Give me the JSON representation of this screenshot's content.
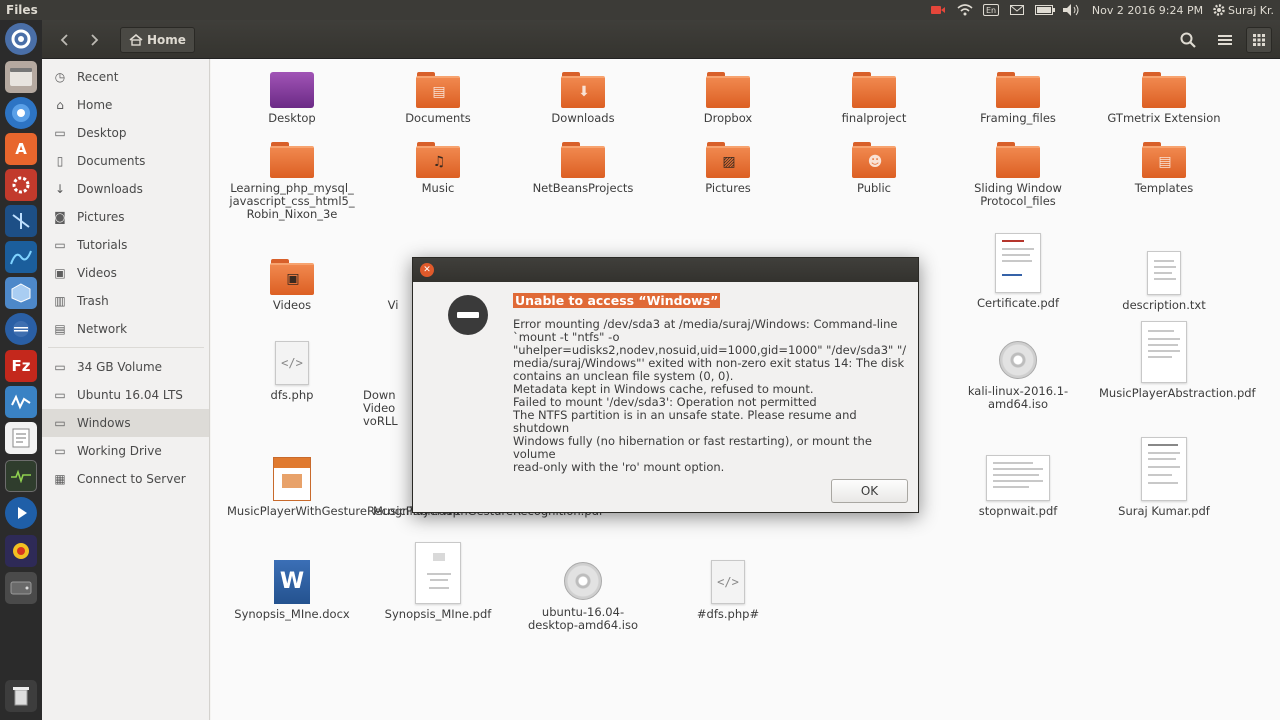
{
  "app_title": "Files",
  "top_panel": {
    "keyboard_layout": "En",
    "datetime": "Nov 2 2016  9:24 PM",
    "user": "Suraj Kr."
  },
  "header": {
    "location": "Home"
  },
  "sidebar": {
    "places": [
      {
        "label": "Recent",
        "icon": "clock-icon"
      },
      {
        "label": "Home",
        "icon": "home-icon"
      },
      {
        "label": "Desktop",
        "icon": "folder-icon"
      },
      {
        "label": "Documents",
        "icon": "document-icon"
      },
      {
        "label": "Downloads",
        "icon": "download-icon"
      },
      {
        "label": "Pictures",
        "icon": "camera-icon"
      },
      {
        "label": "Tutorials",
        "icon": "folder-icon"
      },
      {
        "label": "Videos",
        "icon": "video-icon"
      },
      {
        "label": "Trash",
        "icon": "trash-icon"
      },
      {
        "label": "Network",
        "icon": "network-icon"
      }
    ],
    "devices": [
      {
        "label": "34 GB Volume",
        "icon": "drive-icon"
      },
      {
        "label": "Ubuntu 16.04 LTS",
        "icon": "drive-icon"
      },
      {
        "label": "Windows",
        "icon": "drive-icon"
      },
      {
        "label": "Working Drive",
        "icon": "drive-icon"
      }
    ],
    "connect": {
      "label": "Connect to Server",
      "icon": "server-icon"
    }
  },
  "files": [
    {
      "name": "Desktop",
      "kind": "desktop-folder"
    },
    {
      "name": "Documents",
      "kind": "folder"
    },
    {
      "name": "Downloads",
      "kind": "folder"
    },
    {
      "name": "Dropbox",
      "kind": "folder"
    },
    {
      "name": "finalproject",
      "kind": "folder"
    },
    {
      "name": "Framing_files",
      "kind": "folder"
    },
    {
      "name": "GTmetrix Extension",
      "kind": "folder"
    },
    {
      "name": "Learning_php_mysql_ javascript_css_html5_ Robin_Nixon_3e",
      "kind": "folder"
    },
    {
      "name": "Music",
      "kind": "folder"
    },
    {
      "name": "NetBeansProjects",
      "kind": "folder"
    },
    {
      "name": "Pictures",
      "kind": "folder"
    },
    {
      "name": "Public",
      "kind": "folder"
    },
    {
      "name": "Sliding Window Protocol_files",
      "kind": "folder"
    },
    {
      "name": "Templates",
      "kind": "folder"
    },
    {
      "name": "Videos",
      "kind": "folder"
    },
    {
      "name": "Vi",
      "kind": "file"
    },
    {
      "name": "Certificate.pdf",
      "kind": "pdf"
    },
    {
      "name": "description.txt",
      "kind": "text"
    },
    {
      "name": "dfs.php",
      "kind": "code"
    },
    {
      "name": "Down Video voRLL",
      "kind": "file"
    },
    {
      "name": "kali-linux-2016.1-amd64.iso",
      "kind": "disc"
    },
    {
      "name": "MusicPlayerAbstraction.pdf",
      "kind": "pdf"
    },
    {
      "name": "MusicPlayerWithGestureRecognition.odp",
      "kind": "presentation"
    },
    {
      "name": "MusicPlayerWithGestureRecognition.pdf",
      "kind": "pdf"
    },
    {
      "name": "stopnwait.pdf",
      "kind": "pdf"
    },
    {
      "name": "Suraj Kumar.pdf",
      "kind": "pdf"
    },
    {
      "name": "Synopsis_MIne.docx",
      "kind": "word"
    },
    {
      "name": "Synopsis_MIne.pdf",
      "kind": "pdf"
    },
    {
      "name": "ubuntu-16.04-desktop-amd64.iso",
      "kind": "disc"
    },
    {
      "name": "#dfs.php#",
      "kind": "code"
    }
  ],
  "dialog": {
    "heading": "Unable to access “Windows”",
    "message_lines": [
      "Error mounting /dev/sda3 at /media/suraj/Windows: Command-line",
      "`mount -t \"ntfs\" -o",
      "\"uhelper=udisks2,nodev,nosuid,uid=1000,gid=1000\" \"/dev/sda3\" \"/",
      "media/suraj/Windows\"' exited with non-zero exit status 14: The disk",
      "contains an unclean file system (0, 0).",
      "Metadata kept in Windows cache, refused to mount.",
      "Failed to mount '/dev/sda3': Operation not permitted",
      "The NTFS partition is in an unsafe state. Please resume and shutdown",
      "Windows fully (no hibernation or fast restarting), or mount the volume",
      "read-only with the 'ro' mount option."
    ],
    "ok_label": "OK"
  }
}
